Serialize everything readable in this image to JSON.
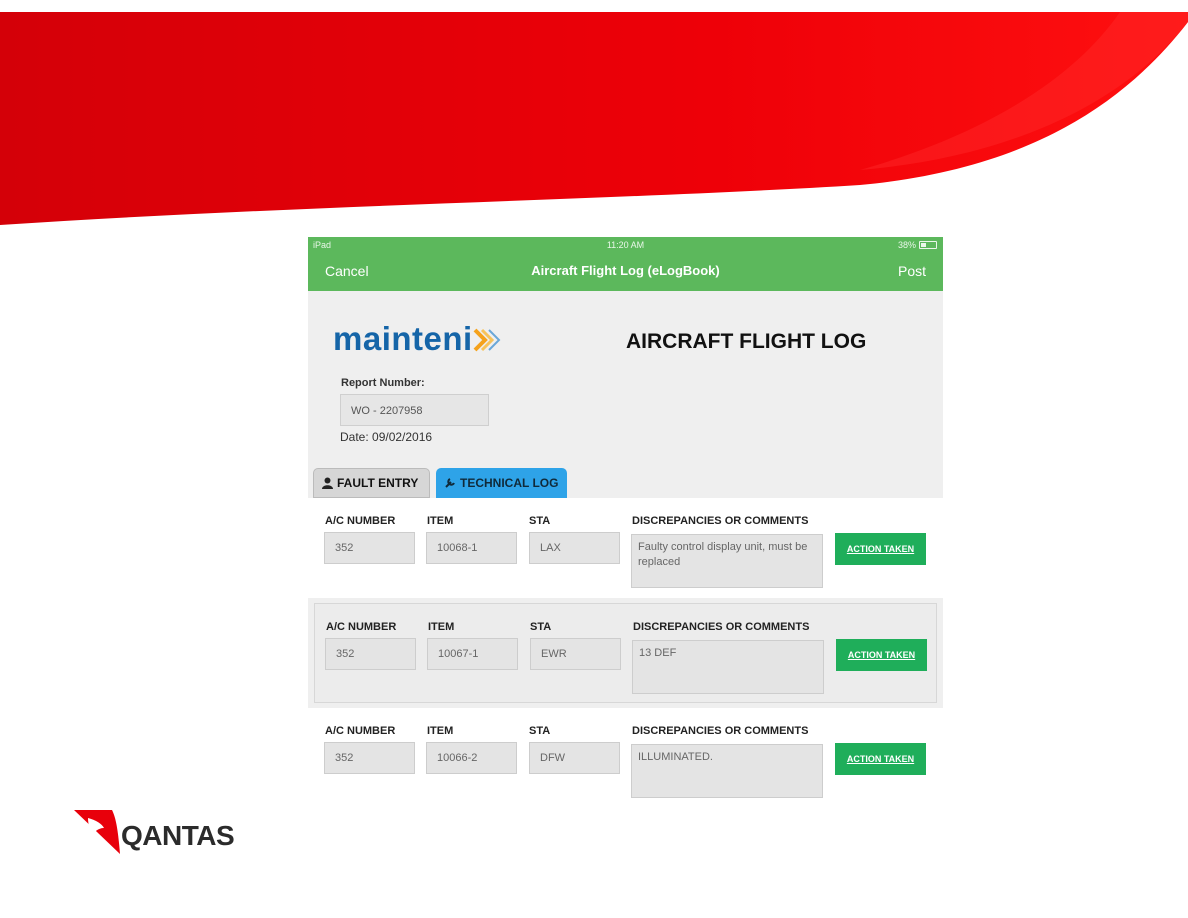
{
  "colors": {
    "brand_red": "#e8000b",
    "nav_green": "#5cb85c",
    "action_green": "#1fae5a",
    "tab_blue": "#2ea3e8",
    "logo_blue": "#1565a8"
  },
  "statusbar": {
    "left": "iPad",
    "time": "11:20 AM",
    "battery": "38%",
    "battery_level": 0.38
  },
  "navbar": {
    "cancel_label": "Cancel",
    "title": "Aircraft Flight Log (eLogBook)",
    "post_label": "Post"
  },
  "header": {
    "logo_text": "mainteni",
    "logo_mark": "x",
    "doc_title": "AIRCRAFT FLIGHT LOG"
  },
  "report": {
    "label": "Report Number:",
    "number": "WO - 2207958",
    "date": "Date: 09/02/2016"
  },
  "tabs": [
    {
      "label": "FAULT ENTRY",
      "icon": "person-icon"
    },
    {
      "label": "TECHNICAL LOG",
      "icon": "wrench-icon"
    }
  ],
  "columns": {
    "ac_number": "A/C NUMBER",
    "item": "ITEM",
    "sta": "STA",
    "comments": "DISCREPANCIES OR COMMENTS"
  },
  "action_label": "ACTION TAKEN",
  "entries": [
    {
      "ac_number": "352",
      "item": "10068-1",
      "sta": "LAX",
      "comment": "Faulty control display unit, must be replaced"
    },
    {
      "ac_number": "352",
      "item": "10067-1",
      "sta": "EWR",
      "comment": "13 DEF"
    },
    {
      "ac_number": "352",
      "item": "10066-2",
      "sta": "DFW",
      "comment": "ILLUMINATED."
    }
  ],
  "footer": {
    "brand": "QANTAS"
  }
}
